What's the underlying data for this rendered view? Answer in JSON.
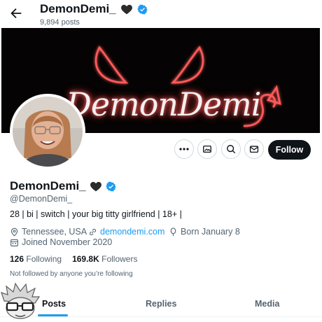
{
  "header": {
    "title": "DemonDemi_",
    "post_count": "9,894 posts"
  },
  "banner": {
    "text": "DemonDemi"
  },
  "actions": {
    "follow_label": "Follow"
  },
  "profile": {
    "display_name": "DemonDemi_",
    "handle": "@DemonDemi_",
    "bio": "28 | bi | switch | your big titty girlfriend | 18+ |",
    "location": "Tennessee, USA",
    "website": "demondemi.com",
    "birthday": "Born January 8",
    "joined": "Joined November 2020"
  },
  "stats": {
    "following_count": "126",
    "following_label": "Following",
    "followers_count": "169.8K",
    "followers_label": "Followers"
  },
  "social_context": "Not followed by anyone you’re following",
  "tabs": [
    {
      "label": "Posts"
    },
    {
      "label": "Replies"
    },
    {
      "label": "Media"
    }
  ],
  "colors": {
    "accent": "#1d9bf0",
    "text": "#0f1419",
    "muted": "#536471",
    "follow_button": "#0f1419",
    "banner_glow": "#ff3b3b"
  }
}
